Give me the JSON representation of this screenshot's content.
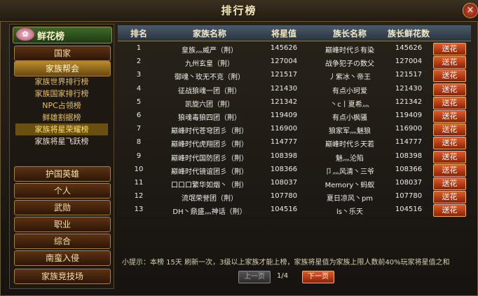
{
  "window": {
    "title": "排行榜",
    "close_label": "×"
  },
  "sidebar": {
    "header": "鲜花榜",
    "header_icon": "rose-icon",
    "buttons_top": [
      "国家",
      "家族帮会"
    ],
    "subitems": [
      "家族世界排行榜",
      "家族国家排行榜",
      "NPC占领榜",
      "鲜雄割据榜",
      "家族将星荣耀榜",
      "家族将星飞跃榜"
    ],
    "buttons_bottom": [
      "护国英雄",
      "个人",
      "武勋",
      "职业",
      "综合",
      "南蛮入侵",
      "家族竞技场"
    ]
  },
  "table": {
    "headers": [
      "排名",
      "家族名称",
      "将星值",
      "族长名称",
      "族长鲜花数"
    ],
    "action_label": "送花",
    "rows": [
      [
        "1",
        "皇族灬威严（荆）",
        "145626",
        "巅峰时代彡有染",
        "145626"
      ],
      [
        "2",
        "九州玄皇（荆）",
        "127004",
        "战争犯子の数父",
        "127004"
      ],
      [
        "3",
        "御魂丶玫无不克（荆）",
        "121517",
        "丿紫冰丶帝王",
        "121517"
      ],
      [
        "4",
        "征战狼魂一团（荆）",
        "121430",
        "有点小珂爱",
        "121430"
      ],
      [
        "5",
        "凯旋六团（荆）",
        "121342",
        "丶c丨夏希灬",
        "121342"
      ],
      [
        "6",
        "狼魂毒狼四团（荆）",
        "119409",
        "有点小枫骚",
        "119409"
      ],
      [
        "7",
        "巅峰时代苍穹团彡（荆）",
        "116900",
        "狼家军灬魅狼",
        "116900"
      ],
      [
        "8",
        "巅峰时代虎翔团彡（荆）",
        "114777",
        "巅峰时代彡天若",
        "114777"
      ],
      [
        "9",
        "巅峰时代国防团彡（荆）",
        "108398",
        "魅灬沦陷",
        "108398"
      ],
      [
        "10",
        "巅峰时代镜谊团彡（荆）",
        "108366",
        "卩灬风清丶三爷",
        "108366"
      ],
      [
        "11",
        "口口口繁华如烟丶（荆）",
        "108037",
        "Memory丶蚂蚁",
        "108037"
      ],
      [
        "12",
        "流氓荣誉团（荆）",
        "107780",
        "夏日凉风丶pm",
        "107780"
      ],
      [
        "13",
        "DH丶鼎盛灬神话（荆）",
        "104516",
        "ls丶乐天",
        "104516"
      ]
    ]
  },
  "footer": {
    "tip": "小提示：本榜 15天  刷新一次，3级以上家族才能上榜，家族将星值为家族上限人数前40%玩家将星值之和",
    "prev": "上一页",
    "next": "下一页",
    "page": "1/4"
  }
}
